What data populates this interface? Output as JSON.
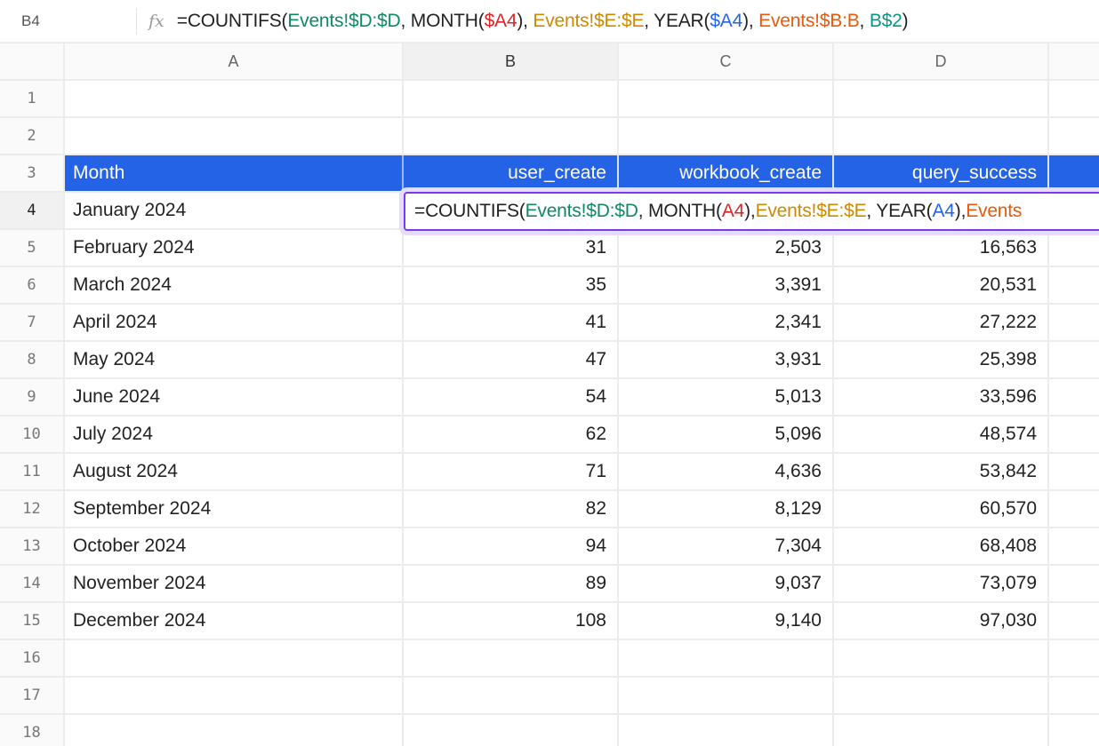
{
  "formula_bar": {
    "cell_ref": "B4",
    "fx_label": "fx",
    "formula_tokens": [
      {
        "text": "=COUNTIFS(",
        "color": "default"
      },
      {
        "text": "Events!$D:$D",
        "color": "green"
      },
      {
        "text": ", MONTH(",
        "color": "default"
      },
      {
        "text": "$A4",
        "color": "red"
      },
      {
        "text": "), ",
        "color": "default"
      },
      {
        "text": "Events!$E:$E",
        "color": "gold"
      },
      {
        "text": ", YEAR(",
        "color": "default"
      },
      {
        "text": "$A4",
        "color": "blue"
      },
      {
        "text": "), ",
        "color": "default"
      },
      {
        "text": "Events!$B:B",
        "color": "orange"
      },
      {
        "text": ", ",
        "color": "default"
      },
      {
        "text": "B$2",
        "color": "teal"
      },
      {
        "text": ")",
        "color": "default"
      }
    ]
  },
  "editor": {
    "cell_ref": "B4",
    "formula_tokens": [
      {
        "text": "=COUNTIFS(",
        "color": "default"
      },
      {
        "text": "Events!$D:$D",
        "color": "green"
      },
      {
        "text": ", MONTH(",
        "color": "default"
      },
      {
        "text": "A4",
        "color": "red"
      },
      {
        "text": "), ",
        "color": "default"
      },
      {
        "text": "Events!$E:$E",
        "color": "gold"
      },
      {
        "text": ", YEAR(",
        "color": "default"
      },
      {
        "text": "A4",
        "color": "blue"
      },
      {
        "text": "), ",
        "color": "default"
      },
      {
        "text": "Events",
        "color": "orange"
      }
    ]
  },
  "colors": {
    "header_fill": "#2563e6",
    "edit_border": "#7c3aed",
    "green": "#0f8a5f",
    "red": "#e02424",
    "gold": "#cc8a00",
    "blue": "#2563eb",
    "orange": "#ea580c",
    "teal": "#0d9488"
  },
  "columns": [
    "A",
    "B",
    "C",
    "D",
    ""
  ],
  "selected_column": "B",
  "selected_row": "4",
  "rows": [
    {
      "num": "1",
      "cells": [
        "",
        "",
        "",
        ""
      ]
    },
    {
      "num": "2",
      "cells": [
        "",
        "",
        "",
        ""
      ]
    },
    {
      "num": "3",
      "cells": [
        "Month",
        "user_create",
        "workbook_create",
        "query_success"
      ],
      "header": true
    },
    {
      "num": "4",
      "cells": [
        "January 2024",
        "",
        "",
        ""
      ]
    },
    {
      "num": "5",
      "cells": [
        "February 2024",
        "31",
        "2,503",
        "16,563"
      ]
    },
    {
      "num": "6",
      "cells": [
        "March 2024",
        "35",
        "3,391",
        "20,531"
      ]
    },
    {
      "num": "7",
      "cells": [
        "April 2024",
        "41",
        "2,341",
        "27,222"
      ]
    },
    {
      "num": "8",
      "cells": [
        "May 2024",
        "47",
        "3,931",
        "25,398"
      ]
    },
    {
      "num": "9",
      "cells": [
        "June 2024",
        "54",
        "5,013",
        "33,596"
      ]
    },
    {
      "num": "10",
      "cells": [
        "July 2024",
        "62",
        "5,096",
        "48,574"
      ]
    },
    {
      "num": "11",
      "cells": [
        "August 2024",
        "71",
        "4,636",
        "53,842"
      ]
    },
    {
      "num": "12",
      "cells": [
        "September 2024",
        "82",
        "8,129",
        "60,570"
      ]
    },
    {
      "num": "13",
      "cells": [
        "October 2024",
        "94",
        "7,304",
        "68,408"
      ]
    },
    {
      "num": "14",
      "cells": [
        "November 2024",
        "89",
        "9,037",
        "73,079"
      ]
    },
    {
      "num": "15",
      "cells": [
        "December 2024",
        "108",
        "9,140",
        "97,030"
      ]
    },
    {
      "num": "16",
      "cells": [
        "",
        "",
        "",
        ""
      ]
    },
    {
      "num": "17",
      "cells": [
        "",
        "",
        "",
        ""
      ]
    },
    {
      "num": "18",
      "cells": [
        "",
        "",
        "",
        ""
      ]
    }
  ]
}
